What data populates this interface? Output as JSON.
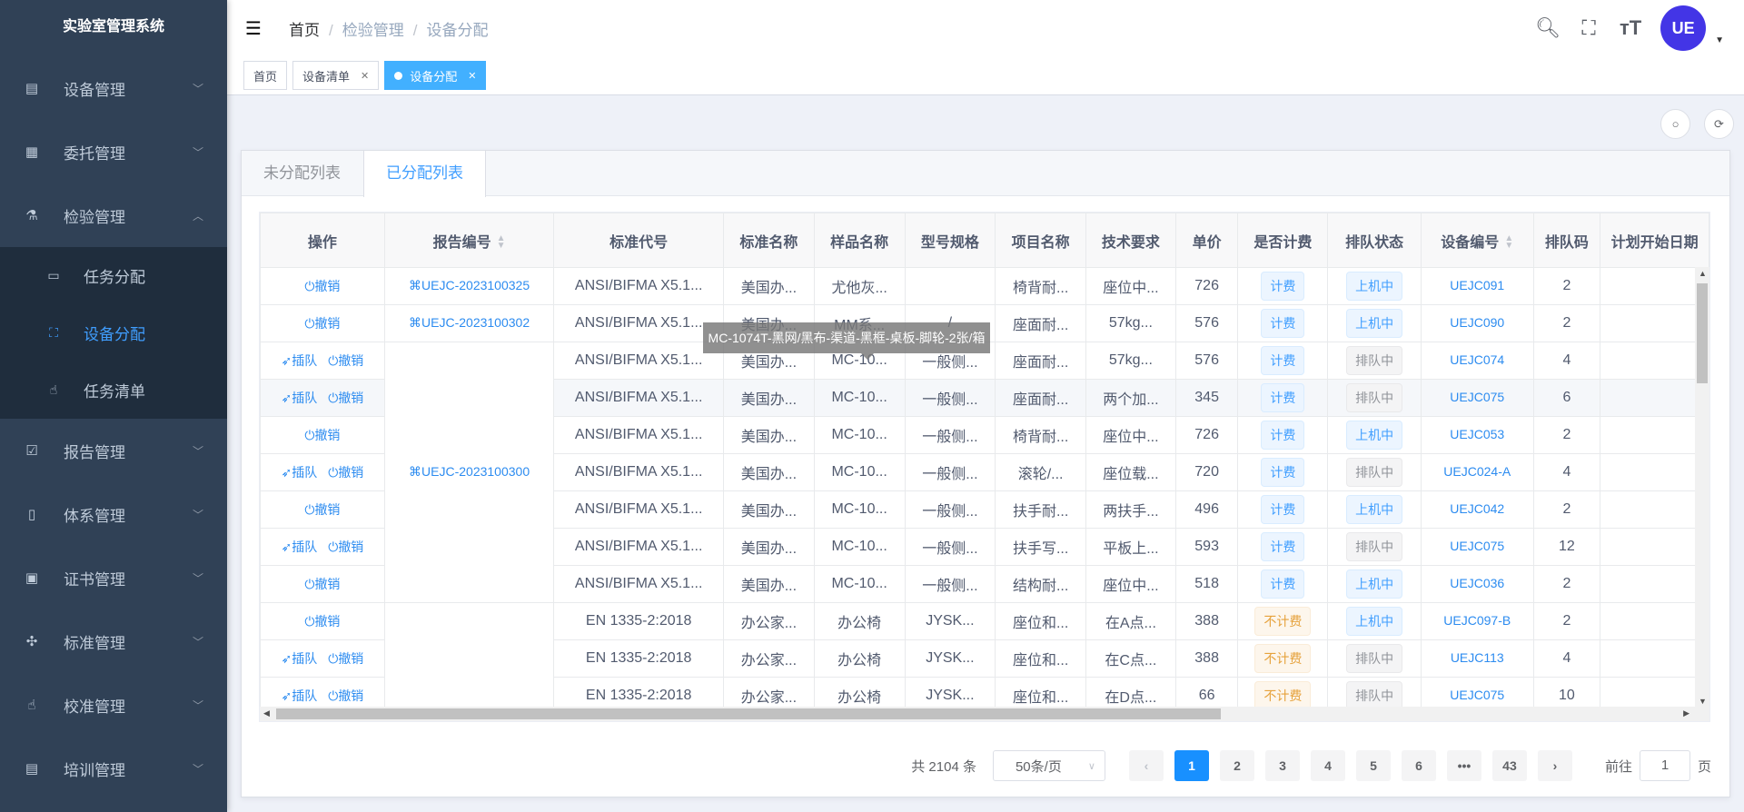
{
  "app_title": "实验室管理系统",
  "sidebar": {
    "items": [
      {
        "label": "设备管理",
        "icon": "server-icon"
      },
      {
        "label": "委托管理",
        "icon": "document-icon"
      },
      {
        "label": "检验管理",
        "icon": "flask-icon",
        "expanded": true
      },
      {
        "label": "报告管理",
        "icon": "checkbox-icon"
      },
      {
        "label": "体系管理",
        "icon": "book-icon"
      },
      {
        "label": "证书管理",
        "icon": "certificate-icon"
      },
      {
        "label": "标准管理",
        "icon": "move-icon"
      },
      {
        "label": "校准管理",
        "icon": "hand-icon"
      },
      {
        "label": "培训管理",
        "icon": "server-icon"
      }
    ],
    "submenu": [
      {
        "label": "任务分配",
        "icon": "calendar-icon"
      },
      {
        "label": "设备分配",
        "icon": "fullscreen-icon",
        "active": true
      },
      {
        "label": "任务清单",
        "icon": "pointer-icon"
      }
    ]
  },
  "header": {
    "breadcrumb": [
      "首页",
      "检验管理",
      "设备分配"
    ],
    "avatar_text": "UE"
  },
  "tags": [
    {
      "label": "首页"
    },
    {
      "label": "设备清单"
    },
    {
      "label": "设备分配",
      "active": true
    }
  ],
  "tabs": [
    "未分配列表",
    "已分配列表"
  ],
  "active_tab": 1,
  "table": {
    "columns": [
      "操作",
      "报告编号",
      "标准代号",
      "标准名称",
      "样品名称",
      "型号规格",
      "项目名称",
      "技术要求",
      "单价",
      "是否计费",
      "排队状态",
      "设备编号",
      "排队码",
      "计划开始日期"
    ],
    "report_groups": [
      {
        "label": "UEJC-2023100325",
        "rows": 1
      },
      {
        "label": "UEJC-2023100302",
        "rows": 1
      },
      {
        "label": "UEJC-2023100300",
        "rows": 7
      },
      {
        "label": "",
        "rows": 3
      }
    ],
    "rows": [
      {
        "ops": [
          "撤销"
        ],
        "std": "ANSI/BIFMA X5.1...",
        "stdname": "美国办...",
        "sample": "尤他灰...",
        "model": "",
        "item": "椅背耐...",
        "req": "座位中...",
        "price": "726",
        "billing": "计费",
        "queue": "上机中",
        "device": "UEJC091",
        "qcode": "2",
        "date": ""
      },
      {
        "ops": [
          "撤销"
        ],
        "std": "ANSI/BIFMA X5.1...",
        "stdname": "美国办...",
        "sample": "MM系...",
        "model": "/",
        "item": "座面耐...",
        "req": "57kg...",
        "price": "576",
        "billing": "计费",
        "queue": "上机中",
        "device": "UEJC090",
        "qcode": "2",
        "date": ""
      },
      {
        "ops": [
          "插队",
          "撤销"
        ],
        "std": "ANSI/BIFMA X5.1...",
        "stdname": "美国办...",
        "sample": "MC-10...",
        "model": "一般侧...",
        "item": "座面耐...",
        "req": "57kg...",
        "price": "576",
        "billing": "计费",
        "queue": "排队中",
        "device": "UEJC074",
        "qcode": "4",
        "date": ""
      },
      {
        "ops": [
          "插队",
          "撤销"
        ],
        "std": "ANSI/BIFMA X5.1...",
        "stdname": "美国办...",
        "sample": "MC-10...",
        "model": "一般侧...",
        "item": "座面耐...",
        "req": "两个加...",
        "price": "345",
        "billing": "计费",
        "queue": "排队中",
        "device": "UEJC075",
        "qcode": "6",
        "date": "",
        "hover": true
      },
      {
        "ops": [
          "撤销"
        ],
        "std": "ANSI/BIFMA X5.1...",
        "stdname": "美国办...",
        "sample": "MC-10...",
        "model": "一般侧...",
        "item": "椅背耐...",
        "req": "座位中...",
        "price": "726",
        "billing": "计费",
        "queue": "上机中",
        "device": "UEJC053",
        "qcode": "2",
        "date": ""
      },
      {
        "ops": [
          "插队",
          "撤销"
        ],
        "std": "ANSI/BIFMA X5.1...",
        "stdname": "美国办...",
        "sample": "MC-10...",
        "model": "一般侧...",
        "item": "滚轮/...",
        "req": "座位载...",
        "price": "720",
        "billing": "计费",
        "queue": "排队中",
        "device": "UEJC024-A",
        "qcode": "4",
        "date": ""
      },
      {
        "ops": [
          "撤销"
        ],
        "std": "ANSI/BIFMA X5.1...",
        "stdname": "美国办...",
        "sample": "MC-10...",
        "model": "一般侧...",
        "item": "扶手耐...",
        "req": "两扶手...",
        "price": "496",
        "billing": "计费",
        "queue": "上机中",
        "device": "UEJC042",
        "qcode": "2",
        "date": ""
      },
      {
        "ops": [
          "插队",
          "撤销"
        ],
        "std": "ANSI/BIFMA X5.1...",
        "stdname": "美国办...",
        "sample": "MC-10...",
        "model": "一般侧...",
        "item": "扶手写...",
        "req": "平板上...",
        "price": "593",
        "billing": "计费",
        "queue": "排队中",
        "device": "UEJC075",
        "qcode": "12",
        "date": ""
      },
      {
        "ops": [
          "撤销"
        ],
        "std": "ANSI/BIFMA X5.1...",
        "stdname": "美国办...",
        "sample": "MC-10...",
        "model": "一般侧...",
        "item": "结构耐...",
        "req": "座位中...",
        "price": "518",
        "billing": "计费",
        "queue": "上机中",
        "device": "UEJC036",
        "qcode": "2",
        "date": ""
      },
      {
        "ops": [
          "撤销"
        ],
        "std": "EN 1335-2:2018",
        "stdname": "办公家...",
        "sample": "办公椅",
        "model": "JYSK...",
        "item": "座位和...",
        "req": "在A点...",
        "price": "388",
        "billing": "不计费",
        "queue": "上机中",
        "device": "UEJC097-B",
        "qcode": "2",
        "date": ""
      },
      {
        "ops": [
          "插队",
          "撤销"
        ],
        "std": "EN 1335-2:2018",
        "stdname": "办公家...",
        "sample": "办公椅",
        "model": "JYSK...",
        "item": "座位和...",
        "req": "在C点...",
        "price": "388",
        "billing": "不计费",
        "queue": "排队中",
        "device": "UEJC113",
        "qcode": "4",
        "date": ""
      },
      {
        "ops": [
          "插队",
          "撤销"
        ],
        "std": "EN 1335-2:2018",
        "stdname": "办公家...",
        "sample": "办公椅",
        "model": "JYSK...",
        "item": "座位和...",
        "req": "在D点...",
        "price": "66",
        "billing": "不计费",
        "queue": "排队中",
        "device": "UEJC075",
        "qcode": "10",
        "date": ""
      }
    ]
  },
  "tooltip": "MC-1074T-黑网/黑布-渠道-黑框-桌板-脚轮-2张/箱",
  "pagination": {
    "total_text": "共 2104 条",
    "page_size": "50条/页",
    "pages": [
      "1",
      "2",
      "3",
      "4",
      "5",
      "6",
      "•••",
      "43"
    ],
    "current": "1",
    "goto_label": "前往",
    "goto_value": "1",
    "page_suffix": "页"
  },
  "colors": {
    "sidebar": "#304156",
    "accent": "#409eff",
    "page_active": "#1890ff",
    "avatar": "#4335e6"
  }
}
